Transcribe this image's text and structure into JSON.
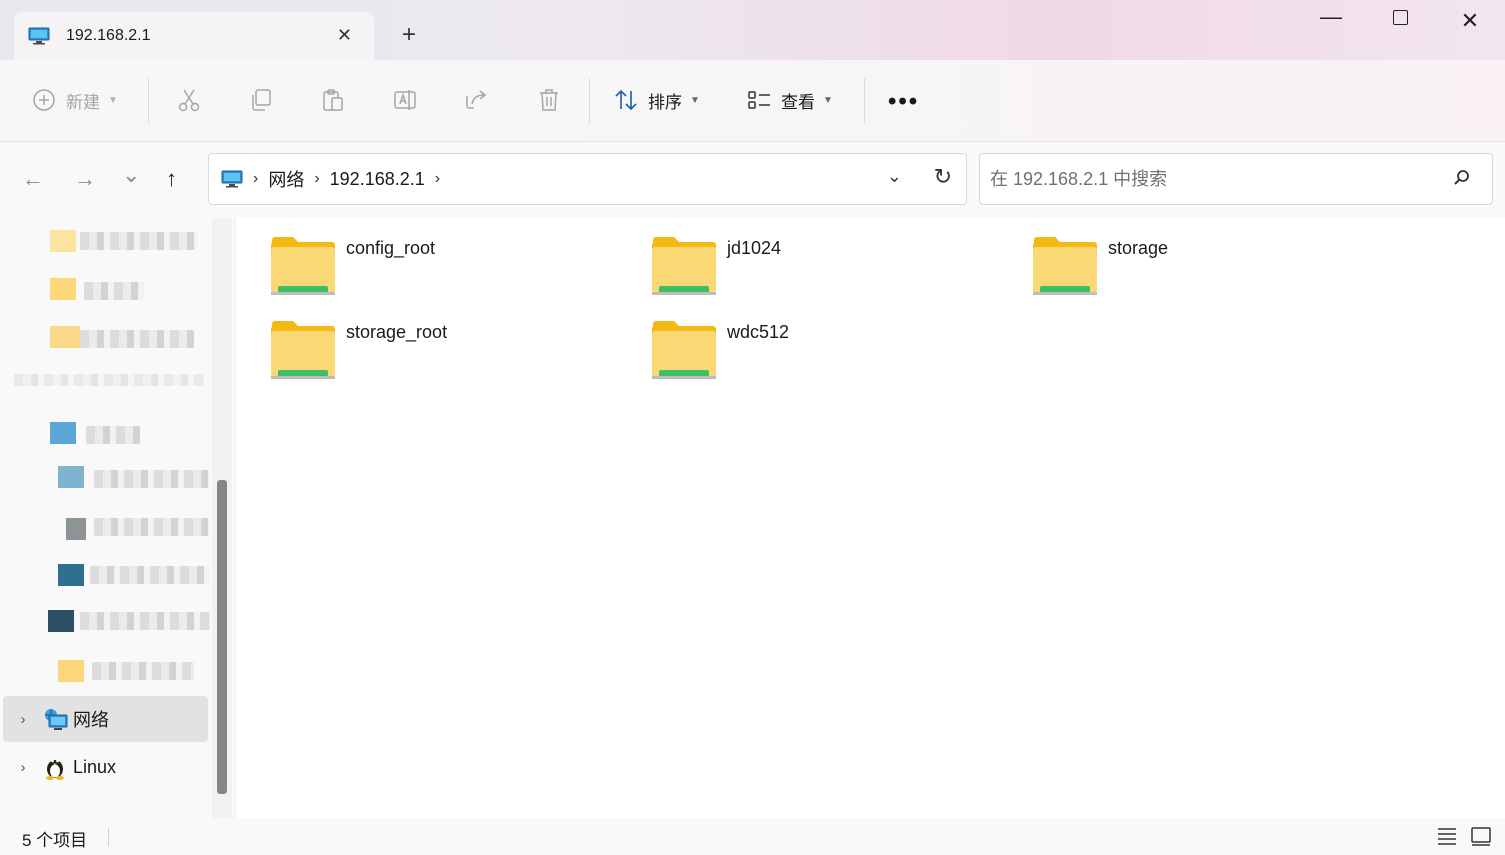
{
  "window": {
    "tab_title": "192.168.2.1",
    "tab_close": "✕",
    "new_tab": "+",
    "minimize": "—",
    "close": "✕"
  },
  "toolbar": {
    "new_label": "新建",
    "sort_label": "排序",
    "view_label": "查看",
    "more": "•••"
  },
  "navbar": {
    "back": "←",
    "forward": "→",
    "recent": "⌄",
    "up": "↑",
    "breadcrumbs": [
      "网络",
      "192.168.2.1"
    ],
    "crumb_sep": "›",
    "dropdown": "⌄",
    "refresh": "↻",
    "search_placeholder": "在 192.168.2.1 中搜索"
  },
  "sidebar": {
    "items": [
      {
        "label": "网络",
        "chevron": "›"
      },
      {
        "label": "Linux",
        "chevron": "›"
      }
    ]
  },
  "content": {
    "folders": [
      {
        "name": "config_root"
      },
      {
        "name": "jd1024"
      },
      {
        "name": "storage"
      },
      {
        "name": "storage_root"
      },
      {
        "name": "wdc512"
      }
    ]
  },
  "status": {
    "item_count": "5 个项目"
  },
  "colors": {
    "folder_yellow": "#f9d66b",
    "folder_tab": "#f5b914",
    "share_green": "#3cc063",
    "monitor_blue": "#2a8fd6",
    "selection_gray": "#e2e2e2"
  }
}
